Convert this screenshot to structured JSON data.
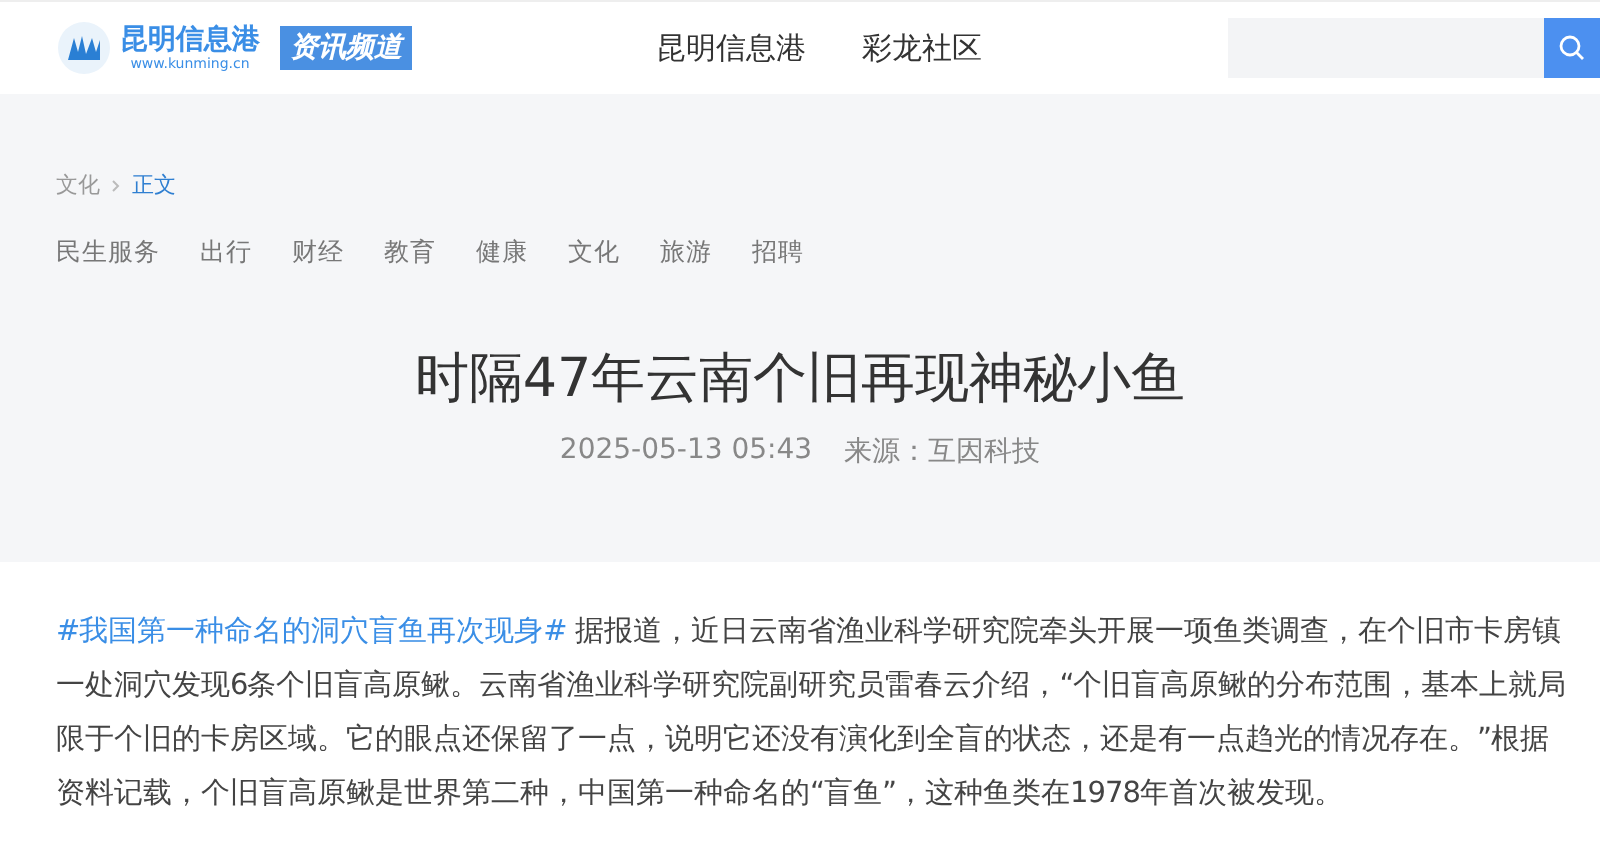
{
  "header": {
    "logo": {
      "name": "昆明信息港",
      "url": "www.kunming.cn",
      "channel": "资讯频道"
    },
    "nav": [
      "昆明信息港",
      "彩龙社区"
    ]
  },
  "breadcrumb": [
    "文化",
    "正文"
  ],
  "categories": [
    "民生服务",
    "出行",
    "财经",
    "教育",
    "健康",
    "文化",
    "旅游",
    "招聘"
  ],
  "article": {
    "title": "时隔47年云南个旧再现神秘小鱼",
    "date": "2025-05-13 05:43",
    "source": "来源：互因科技",
    "topic_link": "#我国第一种命名的洞穴盲鱼再次现身#",
    "text": " 据报道，近日云南省渔业科学研究院牵头开展一项鱼类调查，在个旧市卡房镇一处洞穴发现6条个旧盲高原鳅。云南省渔业科学研究院副研究员雷春云介绍，“个旧盲高原鳅的分布范围，基本上就局限于个旧的卡房区域。它的眼点还保留了一点，说明它还没有演化到全盲的状态，还是有一点趋光的情况存在。”根据资料记载，个旧盲高原鳅是世界第二种，中国第一种命名的“盲鱼”，这种鱼类在1978年首次被发现。"
  }
}
